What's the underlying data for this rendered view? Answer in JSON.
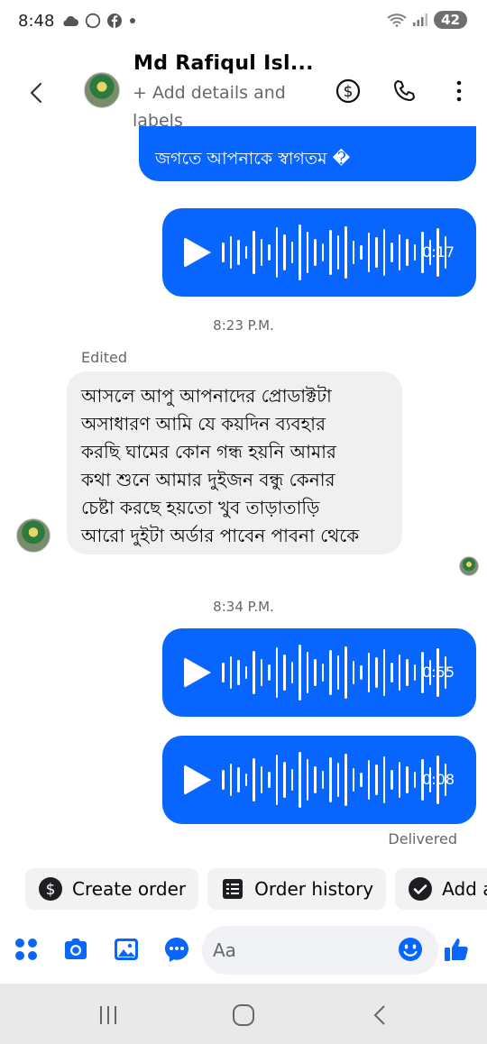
{
  "status_bar": {
    "time": "8:48",
    "battery": "42",
    "left_icons": [
      "cloud-icon",
      "whatsapp-icon",
      "facebook-icon",
      "dot-icon"
    ],
    "right_icons": [
      "wifi-icon",
      "signal-icon",
      "battery-icon"
    ]
  },
  "header": {
    "name": "Md Rafiqul Isl...",
    "subtitle": "+ Add details and labels",
    "icons": [
      "back-arrow-icon",
      "dollar-icon",
      "phone-icon",
      "more-icon"
    ]
  },
  "messages": {
    "top_text": "জগতে আপনাকে স্বাগতম �",
    "audio_1_duration": "0:17",
    "time_1": "8:23 P.M.",
    "edited_label": "Edited",
    "incoming_text_lines": [
      "আসলে আপু আপনাদের প্রোডাক্টটা",
      "অসাধারণ আমি যে কয়দিন ব্যবহার",
      "করছি ঘামের কোন গন্ধ হয়নি আমার",
      "কথা শুনে আমার দুইজন বন্ধু কেনার",
      "চেষ্টা করছে হয়তো খুব তাড়াতাড়ি",
      "আরো দুইটা অর্ডার পাবেন পাবনা থেকে"
    ],
    "time_2": "8:34 P.M.",
    "audio_2_duration": "0:55",
    "audio_3_duration": "0:08",
    "delivered": "Delivered"
  },
  "chips": [
    {
      "label": "Create order",
      "icon": "dollar-icon"
    },
    {
      "label": "Order history",
      "icon": "receipt-icon"
    },
    {
      "label": "Add a",
      "icon": "check-circle-icon"
    }
  ],
  "composer": {
    "placeholder": "Aa",
    "icons": [
      "apps-icon",
      "camera-icon",
      "image-icon",
      "chat-icon",
      "emoji-icon",
      "thumbs-up-icon"
    ]
  },
  "colors": {
    "accent": "#0866ff",
    "incoming_bubble": "#f0f0f0",
    "secondary_text": "#65676b"
  }
}
